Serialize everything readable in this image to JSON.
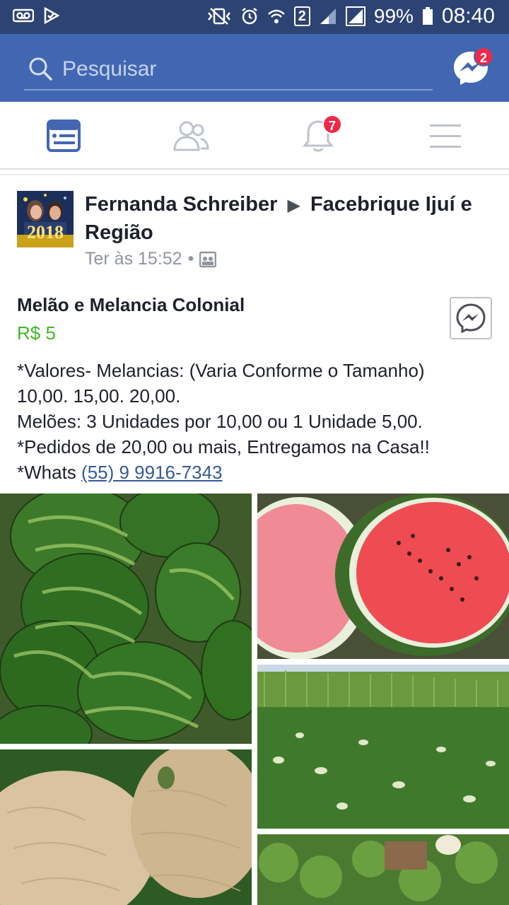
{
  "status_bar": {
    "battery": "99%",
    "time": "08:40",
    "sim": "2"
  },
  "header": {
    "search_placeholder": "Pesquisar",
    "messenger_badge": "2"
  },
  "tabs": {
    "notifications_badge": "7",
    "active": "news-feed",
    "accent": "#4267b2"
  },
  "post": {
    "author": "Fernanda Schreiber",
    "group": "Facebrique Ijuí e Região",
    "avatar_text": "2018",
    "timestamp": "Ter às 15:52",
    "item_title": "Melão e Melancia Colonial",
    "price": "R$ 5",
    "description_lines": [
      "*Valores- Melancias: (Varia Conforme o Tamanho)",
      "10,00. 15,00. 20,00.",
      "Melões: 3 Unidades por 10,00 ou 1 Unidade 5,00.",
      "*Pedidos de 20,00 ou mais, Entregamos na Casa!!"
    ],
    "whats_prefix": "*Whats ",
    "phone": "(55) 9 9916-7343",
    "price_color": "#42b72a"
  }
}
